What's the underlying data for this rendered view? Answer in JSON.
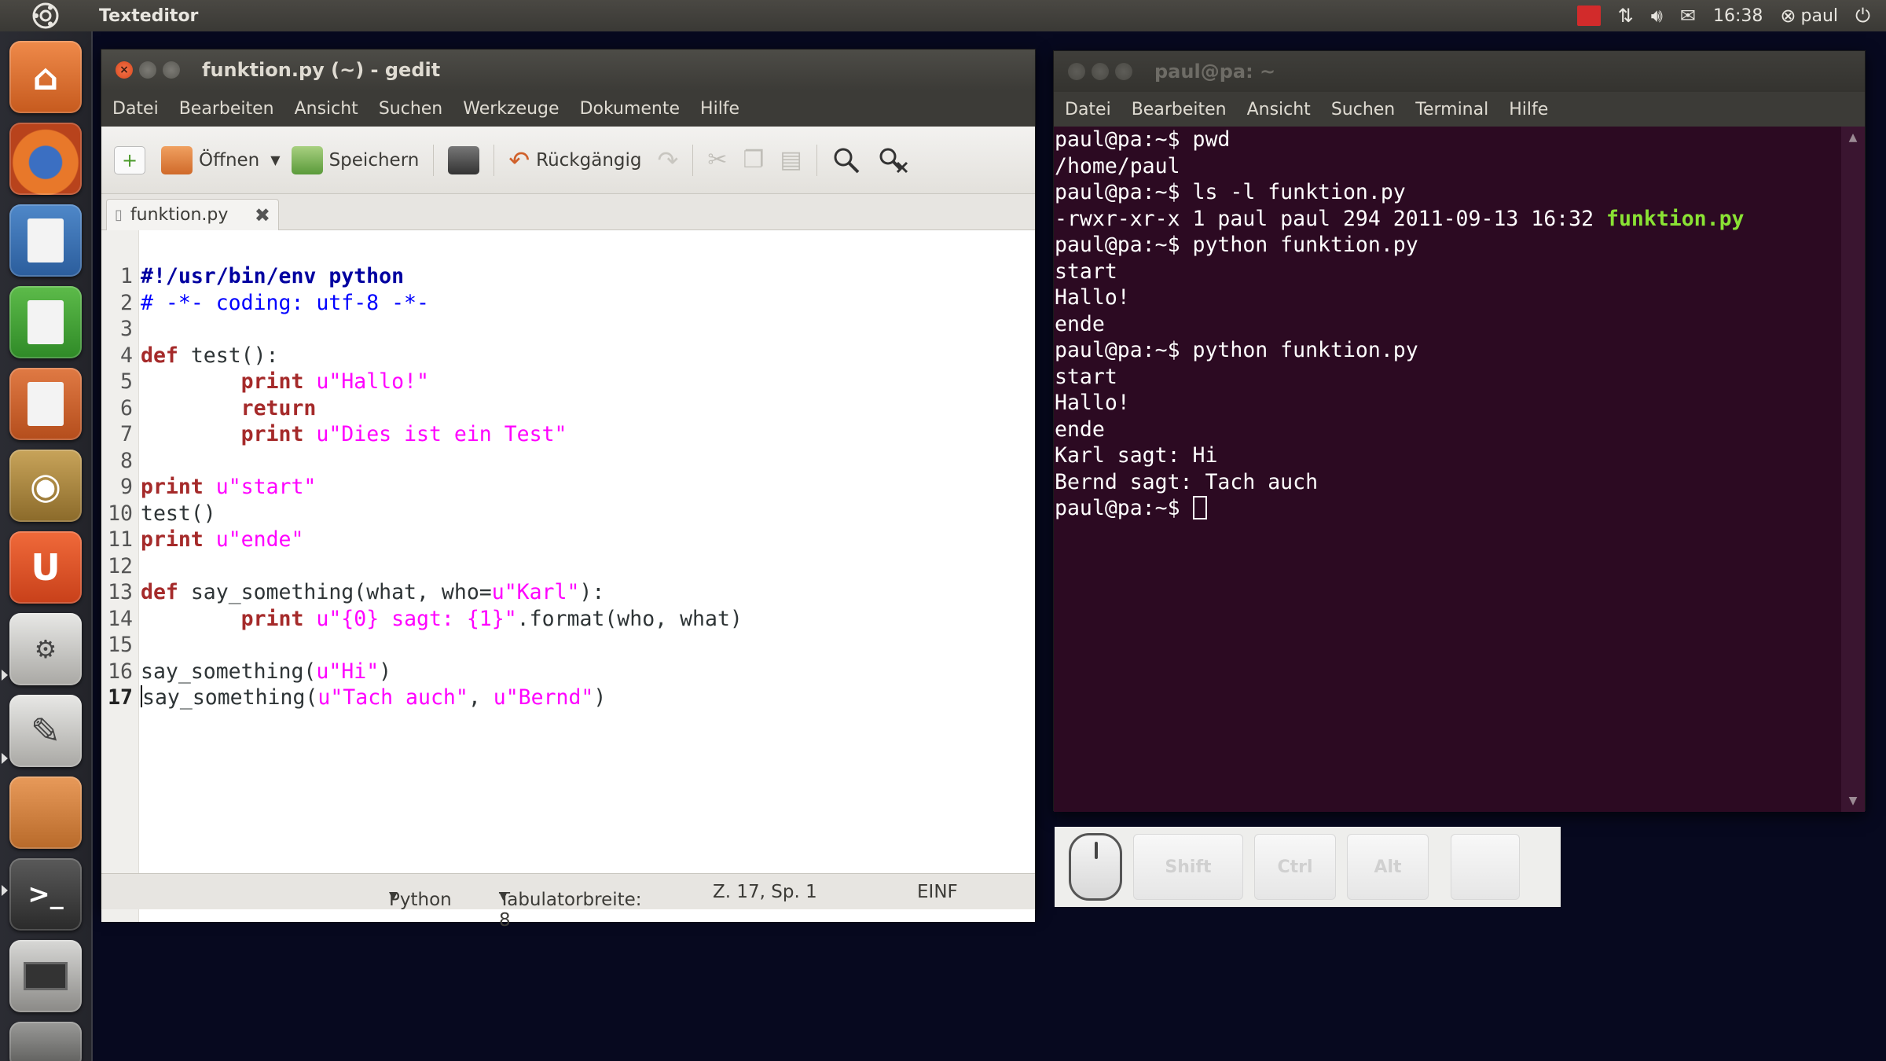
{
  "top_panel": {
    "app_name": "Texteditor",
    "time": "16:38",
    "user": "paul"
  },
  "launcher": {
    "items": [
      "home-folder",
      "firefox",
      "libreoffice-writer",
      "libreoffice-calc",
      "libreoffice-impress",
      "software-center",
      "ubuntu-one",
      "system-settings",
      "text-editor",
      "archive-manager",
      "terminal",
      "screenshot",
      "workspace-switcher"
    ]
  },
  "gedit": {
    "title": "funktion.py (~) - gedit",
    "menu": [
      "Datei",
      "Bearbeiten",
      "Ansicht",
      "Suchen",
      "Werkzeuge",
      "Dokumente",
      "Hilfe"
    ],
    "toolbar": {
      "open_label": "Öffnen",
      "save_label": "Speichern",
      "undo_label": "Rückgängig"
    },
    "tab_label": "funktion.py",
    "code": [
      {
        "n": "1",
        "segs": [
          {
            "c": "shebang",
            "t": "#!/usr/bin/env python"
          }
        ]
      },
      {
        "n": "2",
        "segs": [
          {
            "c": "cmt",
            "t": "# -*- coding: utf-8 -*-"
          }
        ]
      },
      {
        "n": "3",
        "segs": []
      },
      {
        "n": "4",
        "segs": [
          {
            "c": "kw",
            "t": "def"
          },
          {
            "c": "",
            "t": " test():"
          }
        ]
      },
      {
        "n": "5",
        "segs": [
          {
            "c": "",
            "t": "        "
          },
          {
            "c": "kw",
            "t": "print"
          },
          {
            "c": "",
            "t": " "
          },
          {
            "c": "str",
            "t": "u\"Hallo!\""
          }
        ]
      },
      {
        "n": "6",
        "segs": [
          {
            "c": "",
            "t": "        "
          },
          {
            "c": "kw",
            "t": "return"
          }
        ]
      },
      {
        "n": "7",
        "segs": [
          {
            "c": "",
            "t": "        "
          },
          {
            "c": "kw",
            "t": "print"
          },
          {
            "c": "",
            "t": " "
          },
          {
            "c": "str",
            "t": "u\"Dies ist ein Test\""
          }
        ]
      },
      {
        "n": "8",
        "segs": []
      },
      {
        "n": "9",
        "segs": [
          {
            "c": "kw",
            "t": "print"
          },
          {
            "c": "",
            "t": " "
          },
          {
            "c": "str",
            "t": "u\"start\""
          }
        ]
      },
      {
        "n": "10",
        "segs": [
          {
            "c": "",
            "t": "test()"
          }
        ]
      },
      {
        "n": "11",
        "segs": [
          {
            "c": "kw",
            "t": "print"
          },
          {
            "c": "",
            "t": " "
          },
          {
            "c": "str",
            "t": "u\"ende\""
          }
        ]
      },
      {
        "n": "12",
        "segs": []
      },
      {
        "n": "13",
        "segs": [
          {
            "c": "kw",
            "t": "def"
          },
          {
            "c": "",
            "t": " say_something(what, who="
          },
          {
            "c": "str",
            "t": "u\"Karl\""
          },
          {
            "c": "",
            "t": "):"
          }
        ]
      },
      {
        "n": "14",
        "segs": [
          {
            "c": "",
            "t": "        "
          },
          {
            "c": "kw",
            "t": "print"
          },
          {
            "c": "",
            "t": " "
          },
          {
            "c": "str",
            "t": "u\"{0} sagt: {1}\""
          },
          {
            "c": "",
            "t": ".format(who, what)"
          }
        ]
      },
      {
        "n": "15",
        "segs": []
      },
      {
        "n": "16",
        "segs": [
          {
            "c": "",
            "t": "say_something("
          },
          {
            "c": "str",
            "t": "u\"Hi\""
          },
          {
            "c": "",
            "t": ")"
          }
        ]
      },
      {
        "n": "17",
        "segs": [
          {
            "c": "caret",
            "t": ""
          },
          {
            "c": "",
            "t": "say_something("
          },
          {
            "c": "str",
            "t": "u\"Tach auch\""
          },
          {
            "c": "",
            "t": ", "
          },
          {
            "c": "str",
            "t": "u\"Bernd\""
          },
          {
            "c": "",
            "t": ")"
          }
        ]
      }
    ],
    "status": {
      "language": "Python",
      "tab_width": "Tabulatorbreite: 8",
      "position": "Z. 17, Sp. 1",
      "mode": "EINF"
    }
  },
  "terminal": {
    "title": "paul@pa: ~",
    "menu": [
      "Datei",
      "Bearbeiten",
      "Ansicht",
      "Suchen",
      "Terminal",
      "Hilfe"
    ],
    "lines": [
      [
        {
          "c": "",
          "t": "paul@pa:~$ pwd"
        }
      ],
      [
        {
          "c": "",
          "t": "/home/paul"
        }
      ],
      [
        {
          "c": "",
          "t": "paul@pa:~$ ls -l funktion.py"
        }
      ],
      [
        {
          "c": "",
          "t": "-rwxr-xr-x 1 paul paul 294 2011-09-13 16:32 "
        },
        {
          "c": "exec",
          "t": "funktion.py"
        }
      ],
      [
        {
          "c": "",
          "t": "paul@pa:~$ python funktion.py"
        }
      ],
      [
        {
          "c": "",
          "t": "start"
        }
      ],
      [
        {
          "c": "",
          "t": "Hallo!"
        }
      ],
      [
        {
          "c": "",
          "t": "ende"
        }
      ],
      [
        {
          "c": "",
          "t": "paul@pa:~$ python funktion.py"
        }
      ],
      [
        {
          "c": "",
          "t": "start"
        }
      ],
      [
        {
          "c": "",
          "t": "Hallo!"
        }
      ],
      [
        {
          "c": "",
          "t": "ende"
        }
      ],
      [
        {
          "c": "",
          "t": "Karl sagt: Hi"
        }
      ],
      [
        {
          "c": "",
          "t": "Bernd sagt: Tach auch"
        }
      ],
      [
        {
          "c": "",
          "t": "paul@pa:~$ "
        },
        {
          "c": "cursor",
          "t": ""
        }
      ]
    ]
  },
  "keymon": {
    "keys": [
      "Shift",
      "Ctrl",
      "Alt",
      ""
    ]
  },
  "colors": {
    "desktop": "#07091f",
    "terminal_bg": "#2c0a22",
    "keyword": "#a52a2a",
    "string": "#ff00ff",
    "comment": "#0000ff",
    "exec_file": "#8ae234"
  }
}
